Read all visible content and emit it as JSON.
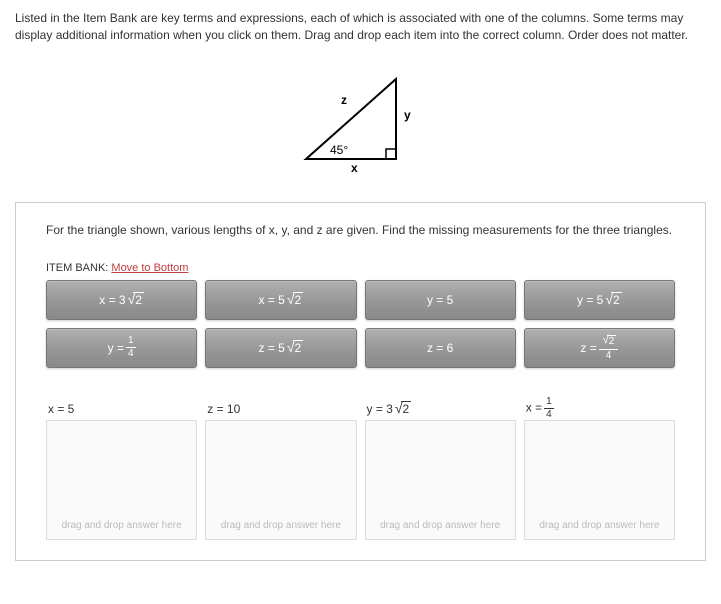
{
  "instructions": "Listed in the Item Bank are key terms and expressions, each of which is associated with one of the columns. Some terms may display additional information when you click on them. Drag and drop each item into the correct column. Order does not matter.",
  "triangle": {
    "label_z": "z",
    "label_y": "y",
    "label_x": "x",
    "angle": "45°"
  },
  "question": "For the triangle shown, various lengths of x, y, and z are given. Find the missing measurements for the three triangles.",
  "itemBank": {
    "label": "ITEM BANK:",
    "linkText": "Move to Bottom",
    "items": [
      {
        "pre": "x = 3",
        "sqrt": "2"
      },
      {
        "pre": "x = 5",
        "sqrt": "2"
      },
      {
        "pre": "y = 5"
      },
      {
        "pre": "y = 5",
        "sqrt": "2"
      },
      {
        "pre": "y =",
        "frac": {
          "num": "1",
          "den": "4"
        }
      },
      {
        "pre": "z = 5",
        "sqrt": "2"
      },
      {
        "pre": "z = 6"
      },
      {
        "pre": "z =",
        "frac": {
          "numSqrt": "2",
          "den": "4"
        }
      }
    ]
  },
  "columns": [
    {
      "header": {
        "pre": "x = 5"
      }
    },
    {
      "header": {
        "pre": "z = 10"
      }
    },
    {
      "header": {
        "pre": "y = 3",
        "sqrt": "2"
      }
    },
    {
      "header": {
        "pre": "x =",
        "frac": {
          "num": "1",
          "den": "4"
        }
      }
    }
  ],
  "dropHint": "drag and drop answer here"
}
